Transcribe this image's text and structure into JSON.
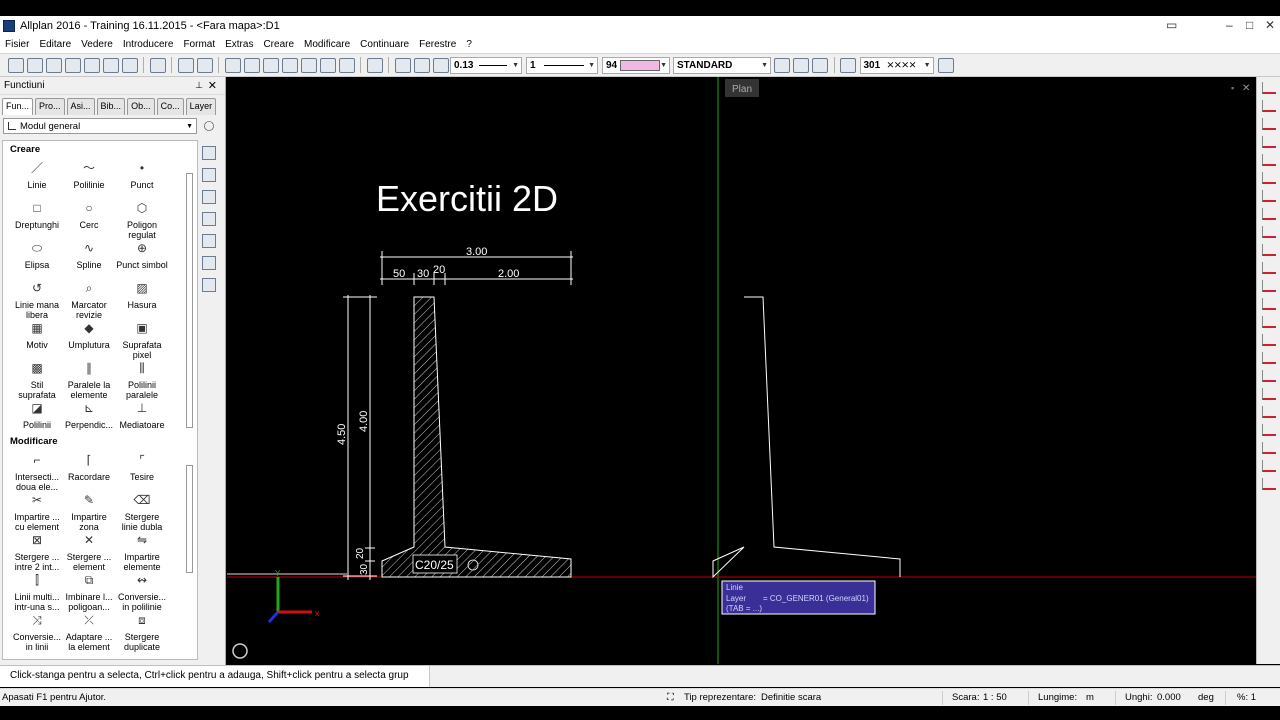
{
  "window": {
    "title": "Allplan 2016 - Training 16.11.2015 - <Fara mapa>:D1"
  },
  "menu": [
    "Fisier",
    "Editare",
    "Vedere",
    "Introducere",
    "Format",
    "Extras",
    "Creare",
    "Modificare",
    "Continuare",
    "Ferestre",
    "?"
  ],
  "toolbar": {
    "pen": "0.13",
    "line": "1",
    "color": "94",
    "layer": "STANDARD",
    "hatch": "301"
  },
  "panel": {
    "title": "Functiuni",
    "tabs": [
      "Fun...",
      "Pro...",
      "Asi...",
      "Bib...",
      "Ob...",
      "Co...",
      "Layer"
    ],
    "module": "Modul general",
    "section_create": "Creare",
    "create_tools": [
      {
        "label": "Linie",
        "icon": "line-icon",
        "glyph": "／"
      },
      {
        "label": "Polilinie",
        "icon": "polyline-icon",
        "glyph": "〜"
      },
      {
        "label": "Punct",
        "icon": "point-icon",
        "glyph": "•"
      },
      {
        "label": "Dreptunghi",
        "icon": "rectangle-icon",
        "glyph": "□"
      },
      {
        "label": "Cerc",
        "icon": "circle-icon",
        "glyph": "○"
      },
      {
        "label": "Poligon regulat",
        "icon": "polygon-icon",
        "glyph": "⬡"
      },
      {
        "label": "Elipsa",
        "icon": "ellipse-icon",
        "glyph": "⬭"
      },
      {
        "label": "Spline",
        "icon": "spline-icon",
        "glyph": "∿"
      },
      {
        "label": "Punct simbol",
        "icon": "symbol-point-icon",
        "glyph": "⊕"
      },
      {
        "label": "Linie mana libera",
        "icon": "freehand-icon",
        "glyph": "↺"
      },
      {
        "label": "Marcator revizie",
        "icon": "revision-marker-icon",
        "glyph": "⌕"
      },
      {
        "label": "Hasura",
        "icon": "hatching-icon",
        "glyph": "▨"
      },
      {
        "label": "Motiv",
        "icon": "pattern-icon",
        "glyph": "▦"
      },
      {
        "label": "Umplutura",
        "icon": "fill-icon",
        "glyph": "◆"
      },
      {
        "label": "Suprafata pixel",
        "icon": "pixel-surface-icon",
        "glyph": "▣"
      },
      {
        "label": "Stil suprafata",
        "icon": "style-area-icon",
        "glyph": "▩"
      },
      {
        "label": "Paralele la elemente",
        "icon": "parallel-icon",
        "glyph": "∥"
      },
      {
        "label": "Polilinii paralele",
        "icon": "parallel-polylines-icon",
        "glyph": "⫼"
      },
      {
        "label": "Polilinii",
        "icon": "polylines-icon",
        "glyph": "◪"
      },
      {
        "label": "Perpendic...",
        "icon": "perpendicular-icon",
        "glyph": "⊾"
      },
      {
        "label": "Mediatoare",
        "icon": "bisector-icon",
        "glyph": "⊥"
      }
    ],
    "section_modify": "Modificare",
    "modify_tools": [
      {
        "label": "Intersecti... doua ele...",
        "icon": "intersect-icon",
        "glyph": "⌐"
      },
      {
        "label": "Racordare",
        "icon": "fillet-icon",
        "glyph": "⌈"
      },
      {
        "label": "Tesire",
        "icon": "chamfer-icon",
        "glyph": "⌜"
      },
      {
        "label": "Impartire ... cu element",
        "icon": "split-element-icon",
        "glyph": "✂"
      },
      {
        "label": "Impartire zona",
        "icon": "split-zone-icon",
        "glyph": "✎"
      },
      {
        "label": "Stergere linie dubla",
        "icon": "delete-double-line-icon",
        "glyph": "⌫"
      },
      {
        "label": "Stergere ... intre 2 int...",
        "icon": "delete-between-icon",
        "glyph": "⊠"
      },
      {
        "label": "Stergere ... element",
        "icon": "delete-segment-icon",
        "glyph": "✕"
      },
      {
        "label": "Impartire elemente",
        "icon": "divide-elements-icon",
        "glyph": "⇋"
      },
      {
        "label": "Linii multi... intr-una s...",
        "icon": "join-lines-icon",
        "glyph": "⫿"
      },
      {
        "label": "Imbinare l... poligoan...",
        "icon": "join-polygons-icon",
        "glyph": "⧉"
      },
      {
        "label": "Conversie... in polilinie",
        "icon": "convert-polyline-icon",
        "glyph": "↭"
      },
      {
        "label": "Conversie... in linii",
        "icon": "convert-lines-icon",
        "glyph": "⤨"
      },
      {
        "label": "Adaptare ... la element",
        "icon": "adapt-element-icon",
        "glyph": "⤫"
      },
      {
        "label": "Stergere duplicate",
        "icon": "delete-duplicates-icon",
        "glyph": "⧈"
      }
    ]
  },
  "viewport": {
    "plan_label": "Plan",
    "heading": "Exercitii 2D",
    "concrete": "C20/25",
    "dims": {
      "total_width": "3.00",
      "d50": "50",
      "d30": "30",
      "d20": "20",
      "d200": "2.00",
      "h450": "4.50",
      "h400": "4.00",
      "h20": "20",
      "h30": "30"
    },
    "tooltip": {
      "line1": "Linie",
      "layer_label": "Layer",
      "layer_value": "= CO_GENER01 (General01)",
      "tab": "(TAB = ...)"
    }
  },
  "status": {
    "message": "Click-stanga pentru a selecta, Ctrl+click pentru a adauga, Shift+click pentru a selecta grup"
  },
  "bottom": {
    "help": "Apasati F1 pentru Ajutor.",
    "repr_label": "Tip reprezentare:",
    "repr_value": "Definitie scara",
    "scale_label": "Scara:",
    "scale_value": "1 : 50",
    "length_label": "Lungime:",
    "length_value": "m",
    "angle_label": "Unghi:",
    "angle_value": "0.000",
    "angle_unit": "deg",
    "percent": "%: 1"
  }
}
